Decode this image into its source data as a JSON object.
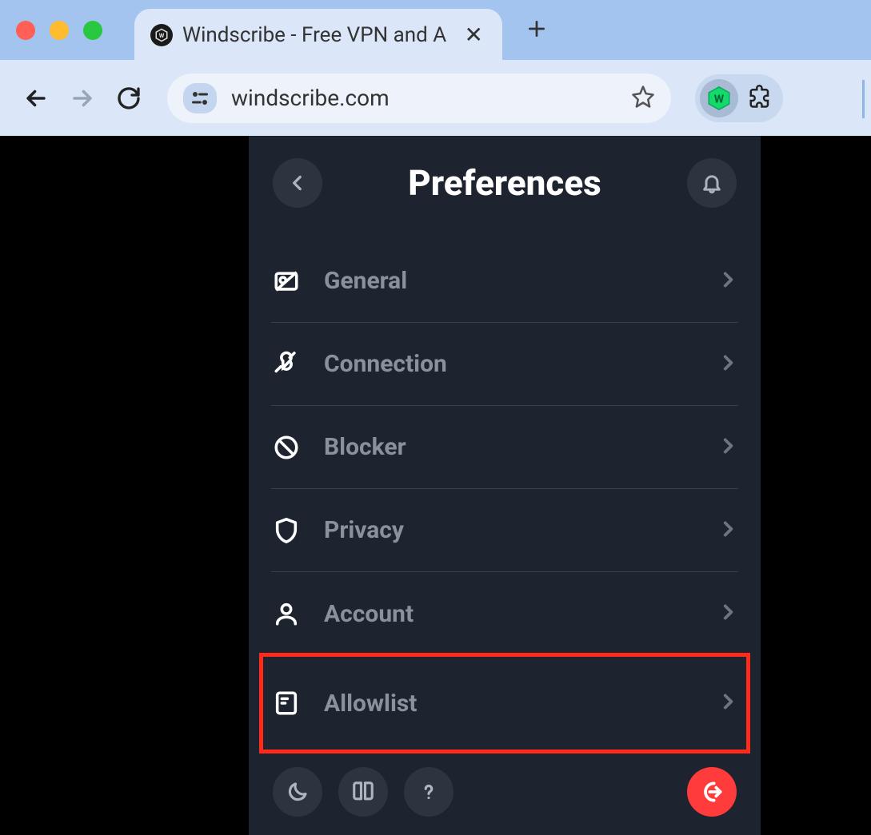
{
  "browser": {
    "tab_title": "Windscribe - Free VPN and A",
    "url": "windscribe.com"
  },
  "popup": {
    "title": "Preferences",
    "menu": [
      {
        "label": "General",
        "icon": "no-image-icon"
      },
      {
        "label": "Connection",
        "icon": "plug-icon"
      },
      {
        "label": "Blocker",
        "icon": "block-icon"
      },
      {
        "label": "Privacy",
        "icon": "shield-icon"
      },
      {
        "label": "Account",
        "icon": "user-icon"
      },
      {
        "label": "Allowlist",
        "icon": "list-icon",
        "highlighted": true
      }
    ]
  }
}
